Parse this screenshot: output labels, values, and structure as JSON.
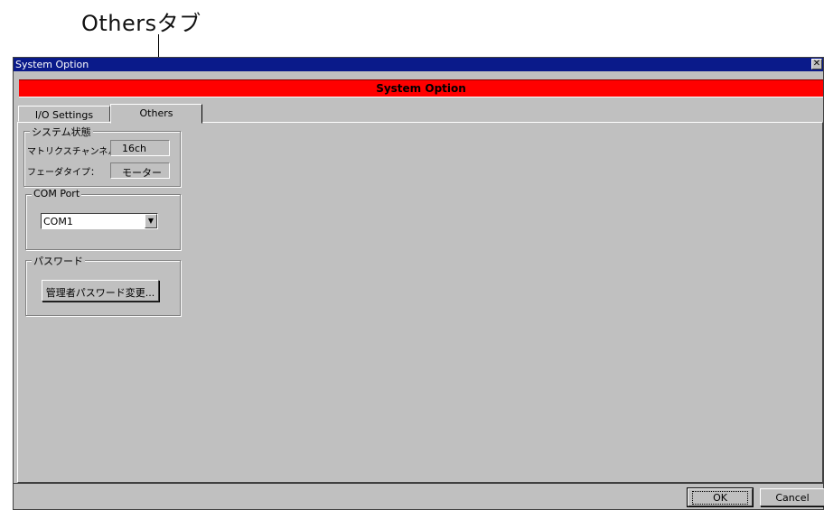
{
  "annotation": {
    "label": "Othersタブ"
  },
  "window": {
    "title": "System Option",
    "close_glyph": "✕",
    "banner_title": "System Option"
  },
  "tabs": [
    {
      "label": "I/O Settings"
    },
    {
      "label": "Others",
      "active": true
    }
  ],
  "system_status": {
    "legend": "システム状態",
    "matrix_label": "マトリクスチャンネル数：",
    "matrix_value": "16ch",
    "fader_label": "フェーダタイプ：",
    "fader_value": "モーター"
  },
  "com_port": {
    "legend": "COM Port",
    "selected": "COM1",
    "arrow": "▼"
  },
  "password": {
    "legend": "パスワード",
    "button_label": "管理者パスワード変更..."
  },
  "buttons": {
    "ok_label": "OK",
    "cancel_label": "Cancel"
  }
}
